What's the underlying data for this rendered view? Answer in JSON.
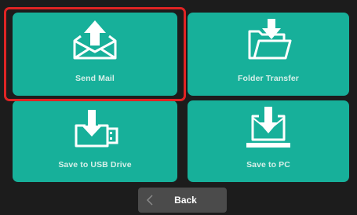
{
  "tiles": [
    {
      "label": "Send Mail",
      "icon": "envelope-upload-icon",
      "selected": true
    },
    {
      "label": "Folder Transfer",
      "icon": "folder-download-icon",
      "selected": false
    },
    {
      "label": "Save to USB Drive",
      "icon": "usb-drive-download-icon",
      "selected": false
    },
    {
      "label": "Save to PC",
      "icon": "laptop-download-icon",
      "selected": false
    }
  ],
  "back": {
    "label": "Back",
    "icon": "chevron-left-icon"
  },
  "colors": {
    "tile": "#17b09a",
    "selection": "#e02424",
    "background": "#1c1c1c",
    "button": "#4b4b4b"
  }
}
